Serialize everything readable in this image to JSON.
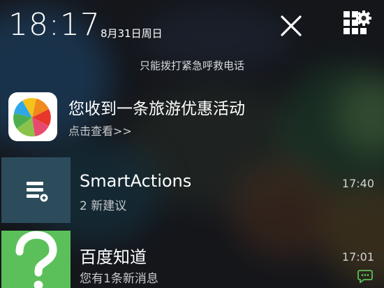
{
  "status": {
    "time": "18:17",
    "date": "8月31日周日"
  },
  "lockscreen": {
    "emergency_text": "只能拨打紧急呼救电话"
  },
  "notifications": [
    {
      "app_icon": "app-store-icon",
      "title": "您收到一条旅游优惠活动",
      "subtitle": "点击查看>>"
    },
    {
      "app_icon": "smartactions-icon",
      "title": "SmartActions",
      "subtitle": "2 新建议",
      "time": "17:40"
    },
    {
      "app_icon": "question-mark-icon",
      "title": "百度知道",
      "subtitle": "您有1条新消息",
      "time": "17:01",
      "badge_icon": "chat-bubble-icon"
    }
  ],
  "colors": {
    "text_primary": "#ffffff",
    "text_secondary": "#c7cacd",
    "smartactions_tile": "#2c4c5c",
    "baidu_tile": "#5cc05a",
    "chat_icon": "#5cc05a"
  }
}
